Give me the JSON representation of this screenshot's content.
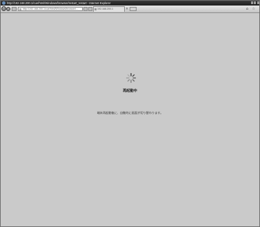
{
  "window": {
    "title": "http://192.168.200.1/cue/html/Windows/browser/restart_restart - Internet Explorer"
  },
  "address_bar": {
    "url": "http://192.168.200.1/cue/html/Windows/browser/..."
  },
  "tab": {
    "label": "192.168.200.1",
    "close_label": "×"
  },
  "toolbar": {
    "right_icons": "⌂ ☆"
  },
  "page": {
    "title": "再起動中",
    "message": "端末再起動後に、自動的に画面が切り替わります。"
  },
  "icons": {
    "browser": "ie-logo-icon",
    "back": "back-arrow-icon",
    "forward": "forward-arrow-icon",
    "loading": "loading-spinner-icon"
  }
}
